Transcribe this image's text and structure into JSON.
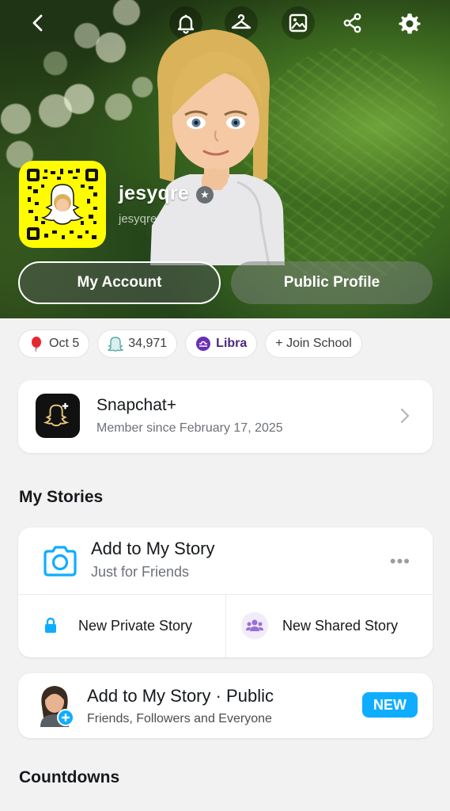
{
  "header": {
    "username": "jesyqre",
    "handle": "jesyqre",
    "buttons": {
      "my_account": "My Account",
      "public_profile": "Public Profile"
    }
  },
  "top_icons": [
    "back-icon",
    "bell-icon",
    "hanger-icon",
    "image-icon",
    "share-icon",
    "gear-icon"
  ],
  "chips": [
    {
      "icon": "balloon-icon",
      "label": "Oct 5"
    },
    {
      "icon": "ghost-icon",
      "label": "34,971"
    },
    {
      "icon": "libra-icon",
      "label": "Libra"
    },
    {
      "icon": "",
      "label": "+ Join School"
    }
  ],
  "snapchat_plus": {
    "title": "Snapchat+",
    "subtitle": "Member since February 17, 2025"
  },
  "my_stories": {
    "section_title": "My Stories",
    "add_story": {
      "title": "Add to My Story",
      "subtitle": "Just for Friends"
    },
    "new_private": "New Private Story",
    "new_shared": "New Shared Story"
  },
  "public_story": {
    "title": "Add to My Story · Public",
    "subtitle": "Friends, Followers and Everyone",
    "badge": "NEW"
  },
  "countdowns": {
    "section_title": "Countdowns"
  },
  "colors": {
    "accent": "#0fadff",
    "snap_yellow": "#fffc00",
    "libra_purple": "#6b2fb3"
  }
}
